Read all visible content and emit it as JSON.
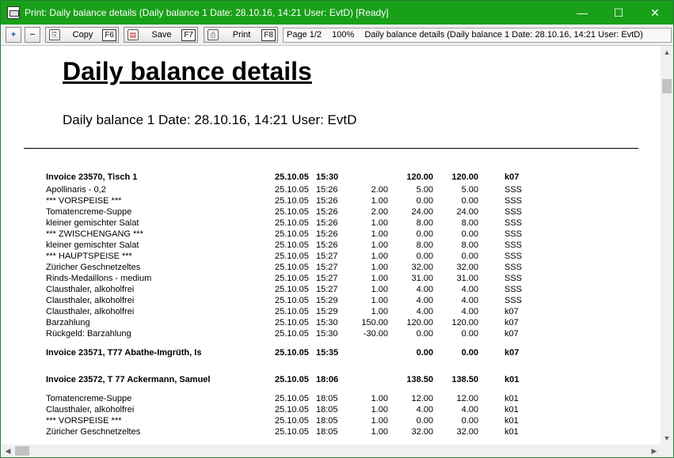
{
  "window": {
    "title": "Print: Daily balance details (Daily balance 1 Date: 28.10.16, 14:21 User: EvtD) [Ready]",
    "minimize": "—",
    "maximize": "☐",
    "close": "✕"
  },
  "toolbar": {
    "zoom_in": "+",
    "zoom_out": "−",
    "copy_label": "Copy",
    "copy_key": "F6",
    "save_label": "Save",
    "save_key": "F7",
    "print_label": "Print",
    "print_key": "F8"
  },
  "status": {
    "page": "Page 1/2",
    "zoom": "100%",
    "doc": "Daily balance details (Daily balance 1 Date: 28.10.16, 14:21 User: EvtD)"
  },
  "document": {
    "title": "Daily balance details",
    "subtitle": "Daily balance 1 Date: 28.10.16, 14:21 User: EvtD"
  },
  "rows": [
    {
      "hdr": true,
      "name": "Invoice    23570, Tisch   1",
      "date": "25.10.05",
      "time": "15:30",
      "qty": "",
      "price": "120.00",
      "total": "120.00",
      "code": "k07"
    },
    {
      "name": "Apollinaris - 0,2",
      "date": "25.10.05",
      "time": "15:26",
      "qty": "2.00",
      "price": "5.00",
      "total": "5.00",
      "code": "SSS"
    },
    {
      "name": "*** VORSPEISE ***",
      "date": "25.10.05",
      "time": "15:26",
      "qty": "1.00",
      "price": "0.00",
      "total": "0.00",
      "code": "SSS"
    },
    {
      "name": "Tomatencreme-Suppe",
      "date": "25.10.05",
      "time": "15:26",
      "qty": "2.00",
      "price": "24.00",
      "total": "24.00",
      "code": "SSS"
    },
    {
      "name": "kleiner gemischter Salat",
      "date": "25.10.05",
      "time": "15:26",
      "qty": "1.00",
      "price": "8.00",
      "total": "8.00",
      "code": "SSS"
    },
    {
      "name": "*** ZWISCHENGANG ***",
      "date": "25.10.05",
      "time": "15:26",
      "qty": "1.00",
      "price": "0.00",
      "total": "0.00",
      "code": "SSS"
    },
    {
      "name": "kleiner gemischter Salat",
      "date": "25.10.05",
      "time": "15:26",
      "qty": "1.00",
      "price": "8.00",
      "total": "8.00",
      "code": "SSS"
    },
    {
      "name": "*** HAUPTSPEISE ***",
      "date": "25.10.05",
      "time": "15:27",
      "qty": "1.00",
      "price": "0.00",
      "total": "0.00",
      "code": "SSS"
    },
    {
      "name": "Züricher Geschnetzeltes",
      "date": "25.10.05",
      "time": "15:27",
      "qty": "1.00",
      "price": "32.00",
      "total": "32.00",
      "code": "SSS"
    },
    {
      "name": "Rinds-Medaillons - medium",
      "date": "25.10.05",
      "time": "15:27",
      "qty": "1.00",
      "price": "31.00",
      "total": "31.00",
      "code": "SSS"
    },
    {
      "name": "Clausthaler, alkoholfrei",
      "date": "25.10.05",
      "time": "15:27",
      "qty": "1.00",
      "price": "4.00",
      "total": "4.00",
      "code": "SSS"
    },
    {
      "name": "Clausthaler, alkoholfrei",
      "date": "25.10.05",
      "time": "15:29",
      "qty": "1.00",
      "price": "4.00",
      "total": "4.00",
      "code": "SSS"
    },
    {
      "name": "Clausthaler, alkoholfrei",
      "date": "25.10.05",
      "time": "15:29",
      "qty": "1.00",
      "price": "4.00",
      "total": "4.00",
      "code": "k07"
    },
    {
      "name": "Barzahlung",
      "date": "25.10.05",
      "time": "15:30",
      "qty": "150.00",
      "price": "120.00",
      "total": "120.00",
      "code": "k07"
    },
    {
      "name": "Rückgeld: Barzahlung",
      "date": "25.10.05",
      "time": "15:30",
      "qty": "-30.00",
      "price": "0.00",
      "total": "0.00",
      "code": "k07"
    },
    {
      "hdr": true,
      "gap": true,
      "name": "Invoice    23571, T77 Abathe-Imgrüth, Is",
      "date": "25.10.05",
      "time": "15:35",
      "qty": "",
      "price": "0.00",
      "total": "0.00",
      "code": "k07"
    },
    {
      "hdr": true,
      "gap": true,
      "name": "Invoice    23572, T 77 Ackermann, Samuel",
      "date": "25.10.05",
      "time": "18:06",
      "qty": "",
      "price": "138.50",
      "total": "138.50",
      "code": "k01"
    },
    {
      "name": "Tomatencreme-Suppe",
      "date": "25.10.05",
      "time": "18:05",
      "qty": "1.00",
      "price": "12.00",
      "total": "12.00",
      "code": "k01"
    },
    {
      "name": "Clausthaler, alkoholfrei",
      "date": "25.10.05",
      "time": "18:05",
      "qty": "1.00",
      "price": "4.00",
      "total": "4.00",
      "code": "k01"
    },
    {
      "name": "*** VORSPEISE ***",
      "date": "25.10.05",
      "time": "18:05",
      "qty": "1.00",
      "price": "0.00",
      "total": "0.00",
      "code": "k01"
    },
    {
      "name": "Züricher Geschnetzeltes",
      "date": "25.10.05",
      "time": "18:05",
      "qty": "1.00",
      "price": "32.00",
      "total": "32.00",
      "code": "k01"
    }
  ]
}
